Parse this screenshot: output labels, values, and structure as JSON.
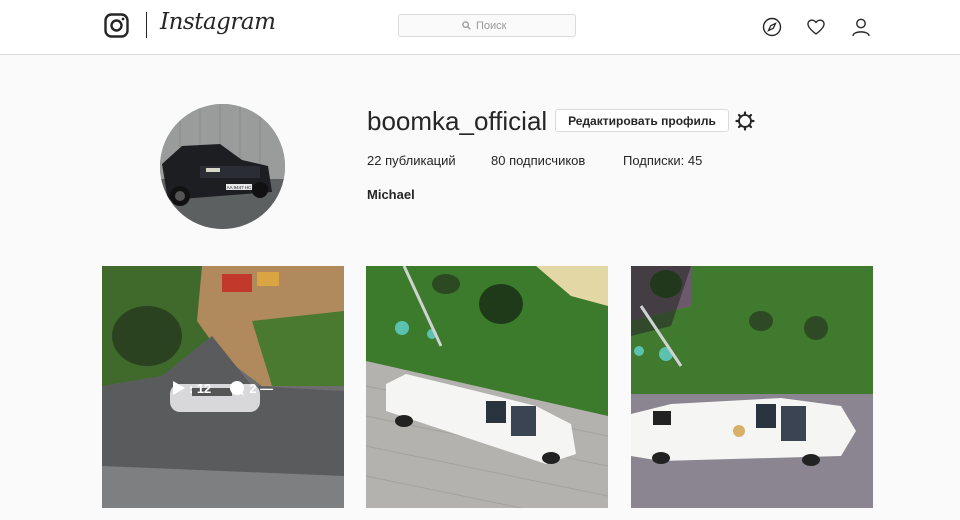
{
  "header": {
    "wordmark": "Instagram",
    "search_placeholder": "Поиск",
    "icons": [
      "instagram-logo-icon",
      "search-icon",
      "compass-icon",
      "heart-icon",
      "person-icon"
    ]
  },
  "profile": {
    "username": "boomka_official",
    "edit_button": "Редактировать профиль",
    "posts_stat": "22 публикаций",
    "followers_stat": "80 подписчиков",
    "following_stat": "Подписки: 45",
    "full_name": "Michael",
    "avatar_plate": "AA 9447 HC"
  },
  "posts": [
    {
      "views": ": 12",
      "comments": "2 —"
    },
    {},
    {}
  ]
}
